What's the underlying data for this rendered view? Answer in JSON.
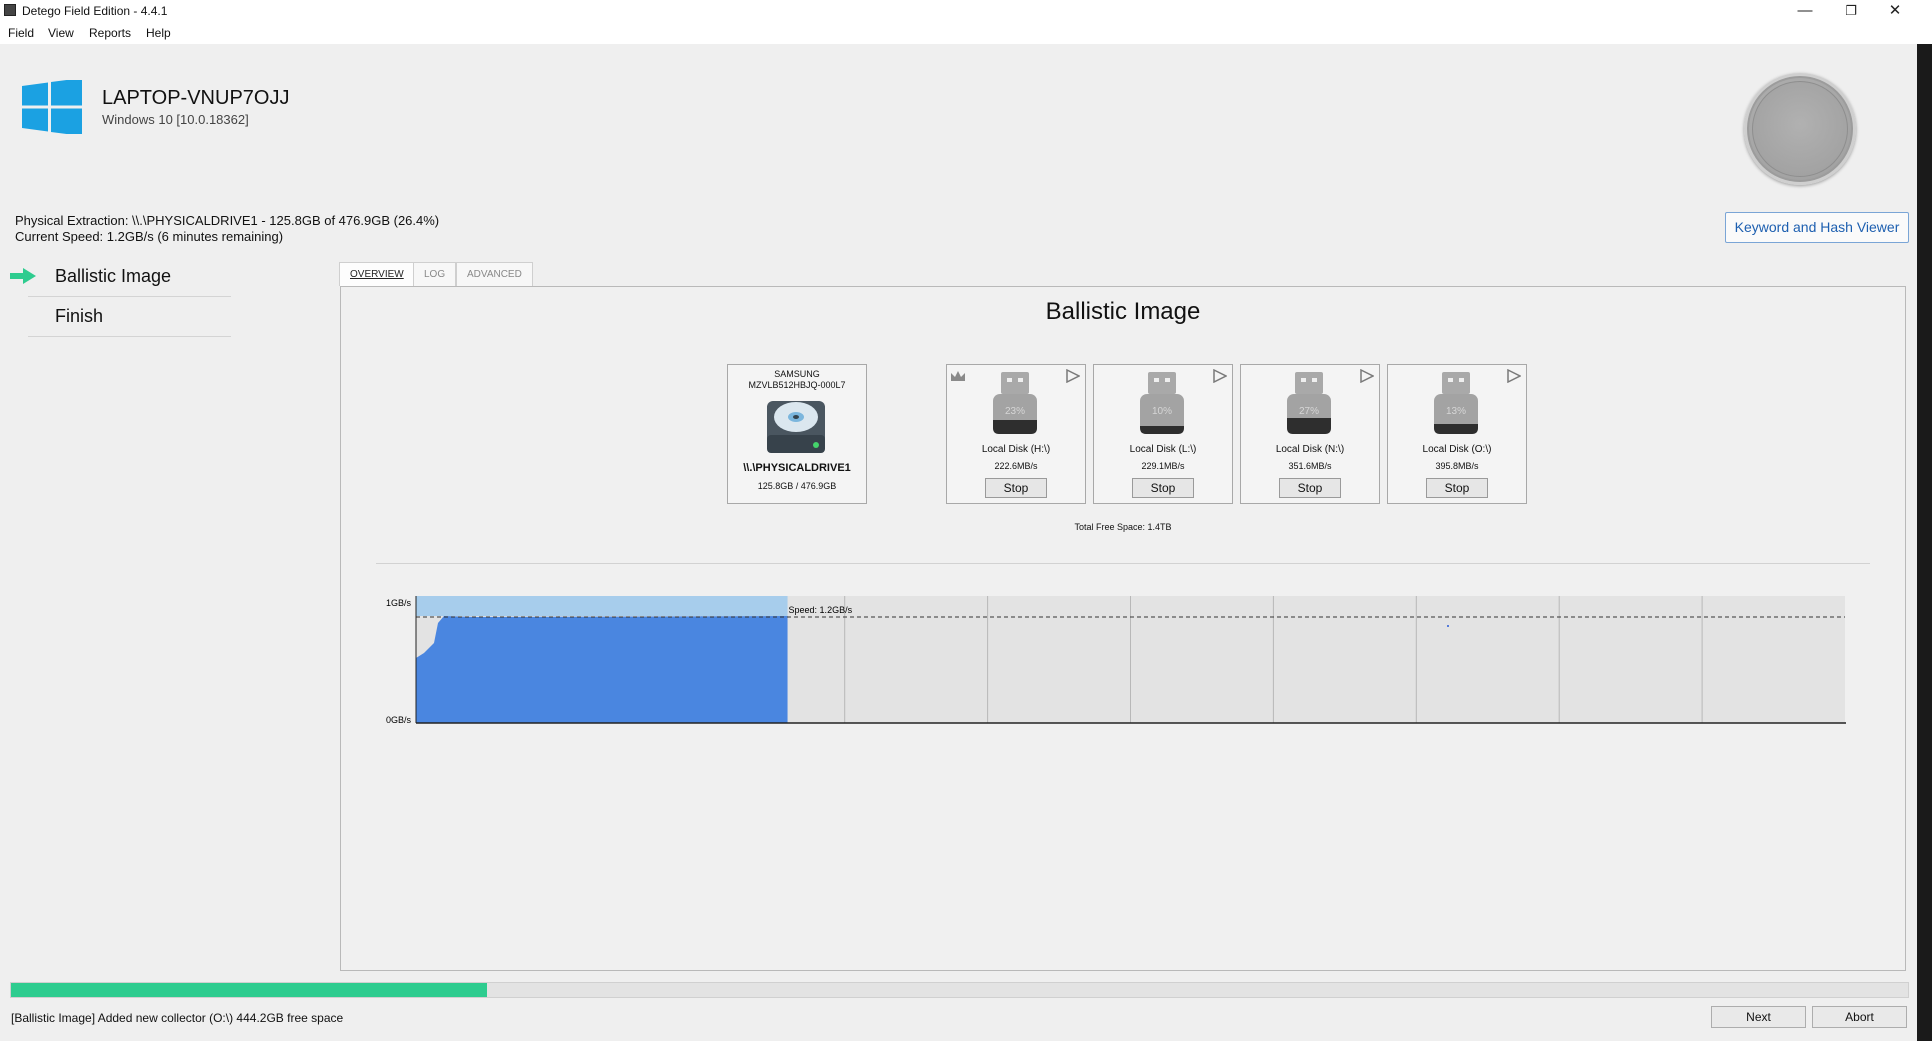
{
  "window": {
    "title": "Detego Field Edition - 4.4.1",
    "minimize_glyph": "—",
    "restore_glyph": "❐",
    "close_glyph": "✕"
  },
  "menu": [
    "Field",
    "View",
    "Reports",
    "Help"
  ],
  "host": {
    "name": "LAPTOP-VNUP7OJJ",
    "os": "Windows 10 [10.0.18362]",
    "logo_color": "#1ba1e2"
  },
  "extraction": {
    "line": "Physical Extraction: \\\\.\\PHYSICALDRIVE1 - 125.8GB of 476.9GB (26.4%)",
    "speed": "Current Speed: 1.2GB/s (6 minutes remaining)"
  },
  "keyword_button": "Keyword and Hash Viewer",
  "steps": [
    {
      "label": "Ballistic Image",
      "active": true
    },
    {
      "label": "Finish",
      "active": false
    }
  ],
  "tabs": [
    "OVERVIEW",
    "LOG",
    "ADVANCED"
  ],
  "panel_title": "Ballistic Image",
  "source": {
    "vendor": "SAMSUNG",
    "model": "MZVLB512HBJQ-000L7",
    "name": "\\\\.\\PHYSICALDRIVE1",
    "size": "125.8GB / 476.9GB"
  },
  "targets": [
    {
      "pct": "23%",
      "name": "Local Disk (H:\\)",
      "rate": "222.6MB/s",
      "button": "Stop",
      "primary": true
    },
    {
      "pct": "10%",
      "name": "Local Disk (L:\\)",
      "rate": "229.1MB/s",
      "button": "Stop",
      "primary": false
    },
    {
      "pct": "27%",
      "name": "Local Disk (N:\\)",
      "rate": "351.6MB/s",
      "button": "Stop",
      "primary": false
    },
    {
      "pct": "13%",
      "name": "Local Disk (O:\\)",
      "rate": "395.8MB/s",
      "button": "Stop",
      "primary": false
    }
  ],
  "free_space": "Total Free Space: 1.4TB",
  "chart_data": {
    "type": "area",
    "y_tick_labels": [
      "1GB/s",
      "0GB/s"
    ],
    "annotation": "Speed: 1.2GB/s",
    "grid": true,
    "fill_color": "#4a86e0",
    "elapsed_fraction": 0.26
  },
  "progress": {
    "fraction": 0.264,
    "color": "#2ecc8f"
  },
  "status_text": "[Ballistic Image] Added new collector (O:\\) 444.2GB free space",
  "footer": {
    "next": "Next",
    "abort": "Abort"
  }
}
